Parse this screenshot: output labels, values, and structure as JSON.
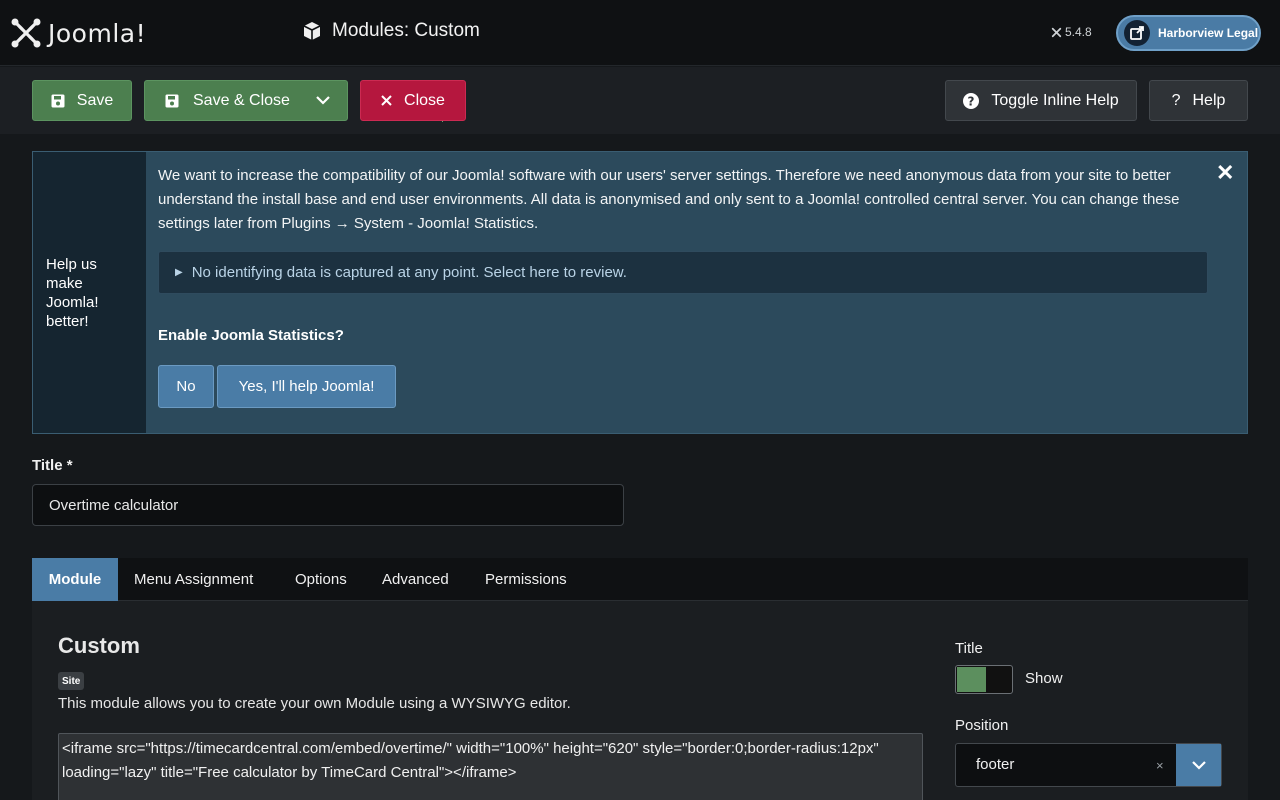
{
  "header": {
    "logo_text": "Joomla!",
    "page_title": "Modules: Custom",
    "version": "5.4.8",
    "site_name": "Harborview Legal",
    "icons": [
      "joomla-logo-icon",
      "cube-icon",
      "joomla-small-icon",
      "external-link-icon"
    ]
  },
  "toolbar": {
    "save": "Save",
    "save_close": "Save & Close",
    "close": "Close",
    "toggle_help": "Toggle Inline Help",
    "help": "Help",
    "colors": {
      "green": "#4c7f4f",
      "red": "#b5173e",
      "dark": "#2f3337"
    }
  },
  "stats": {
    "side_label": "Help us make Joomla! better!",
    "message": "We want to increase the compatibility of our Joomla! software with our users' server settings. Therefore we need anonymous data from your site to better understand the install base and end user environments. All data is anonymised and only sent to a Joomla! controlled central server. You can change these settings later from Plugins → System - Joomla! Statistics.",
    "details": "No identifying data is captured at any point. Select here to review.",
    "question": "Enable Joomla Statistics?",
    "no": "No",
    "yes": "Yes, I'll help Joomla!"
  },
  "title_field": {
    "label": "Title *",
    "value": "Overtime calculator"
  },
  "tabs": [
    {
      "label": "Module",
      "active": true
    },
    {
      "label": "Menu Assignment",
      "active": false
    },
    {
      "label": "Options",
      "active": false
    },
    {
      "label": "Advanced",
      "active": false
    },
    {
      "label": "Permissions",
      "active": false
    }
  ],
  "module": {
    "heading": "Custom",
    "badge": "Site",
    "description": "This module allows you to create your own Module using a WYSIWYG editor.",
    "editor_content": "<iframe src=\"https://timecardcentral.com/embed/overtime/\" width=\"100%\" height=\"620\" style=\"border:0;border-radius:12px\" loading=\"lazy\" title=\"Free calculator by TimeCard Central\"></iframe>"
  },
  "sidebar": {
    "title_label": "Title",
    "title_toggle": "Show",
    "title_shown": true,
    "position_label": "Position",
    "position_value": "footer",
    "clear_symbol": "×"
  },
  "accent": "#4a7ca6"
}
